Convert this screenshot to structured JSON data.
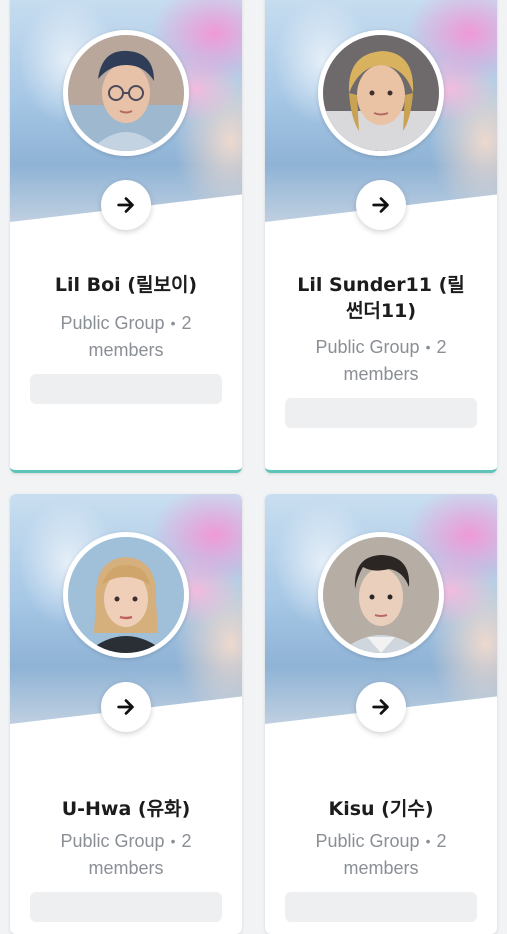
{
  "groups": [
    {
      "name": "Lil Boi (릴보이)",
      "type": "Public Group",
      "separator": "•",
      "count_line": "2",
      "members_label": "members",
      "avatar": "portrait-glasses",
      "arrow_icon": "arrow-right-icon"
    },
    {
      "name": "Lil Sunder11 (릴 썬더11)",
      "type": "Public Group",
      "separator": "•",
      "count_line": "2",
      "members_label": "members",
      "avatar": "portrait-blond",
      "arrow_icon": "arrow-right-icon"
    },
    {
      "name": "U-Hwa (유화)",
      "type": "Public Group",
      "separator": "•",
      "count_line": "2",
      "members_label": "members",
      "avatar": "portrait-bangs",
      "arrow_icon": "arrow-right-icon"
    },
    {
      "name": "Kisu (기수)",
      "type": "Public Group",
      "separator": "•",
      "count_line": "2",
      "members_label": "members",
      "avatar": "portrait-suit",
      "arrow_icon": "arrow-right-icon"
    }
  ],
  "colors": {
    "accent": "#5ec3b8",
    "cover_blue": "#a7c8e6",
    "cover_pink": "#f296d6",
    "text_dark": "#1c1c1c",
    "text_muted": "#8a8f96"
  }
}
